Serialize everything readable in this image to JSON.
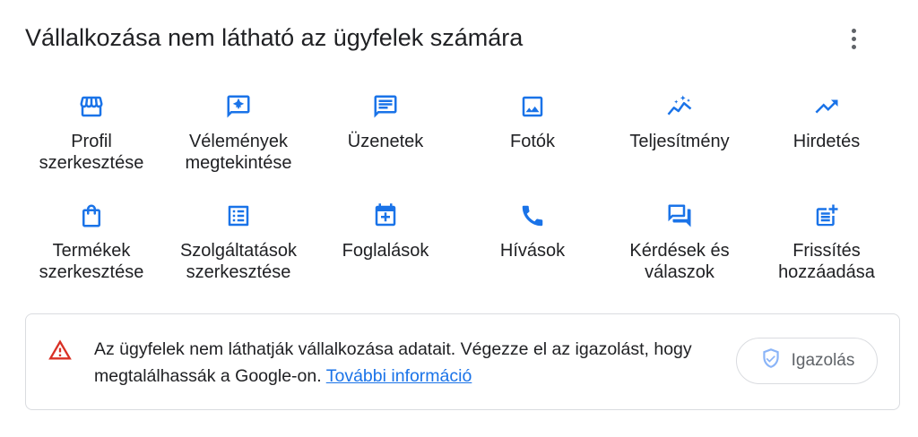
{
  "header": {
    "title": "Vállalkozása nem látható az ügyfelek számára",
    "menu_icon": "more-vert-icon"
  },
  "accent_color": "#1a73e8",
  "actions": [
    {
      "label": "Profil\nszerkesztése",
      "icon": "storefront-icon"
    },
    {
      "label": "Vélemények\nmegtekintése",
      "icon": "review-star-icon"
    },
    {
      "label": "Üzenetek",
      "icon": "message-icon"
    },
    {
      "label": "Fotók",
      "icon": "photo-icon"
    },
    {
      "label": "Teljesítmény",
      "icon": "performance-sparkle-icon"
    },
    {
      "label": "Hirdetés",
      "icon": "trending-up-icon"
    },
    {
      "label": "Termékek\nszerkesztése",
      "icon": "shopping-bag-icon"
    },
    {
      "label": "Szolgáltatások\nszerkesztése",
      "icon": "list-icon"
    },
    {
      "label": "Foglalások",
      "icon": "calendar-add-icon"
    },
    {
      "label": "Hívások",
      "icon": "phone-icon"
    },
    {
      "label": "Kérdések és\nválaszok",
      "icon": "forum-icon"
    },
    {
      "label": "Frissítés\nhozzáadása",
      "icon": "post-add-icon"
    }
  ],
  "alert": {
    "icon": "warning-icon",
    "text": "Az ügyfelek nem láthatják vállalkozása adatait. Végezze el az igazolást, hogy megtalálhassák a Google-on.",
    "link_text": "További információ",
    "button_label": "Igazolás",
    "button_icon": "shield-check-icon",
    "warning_color": "#d93025"
  }
}
